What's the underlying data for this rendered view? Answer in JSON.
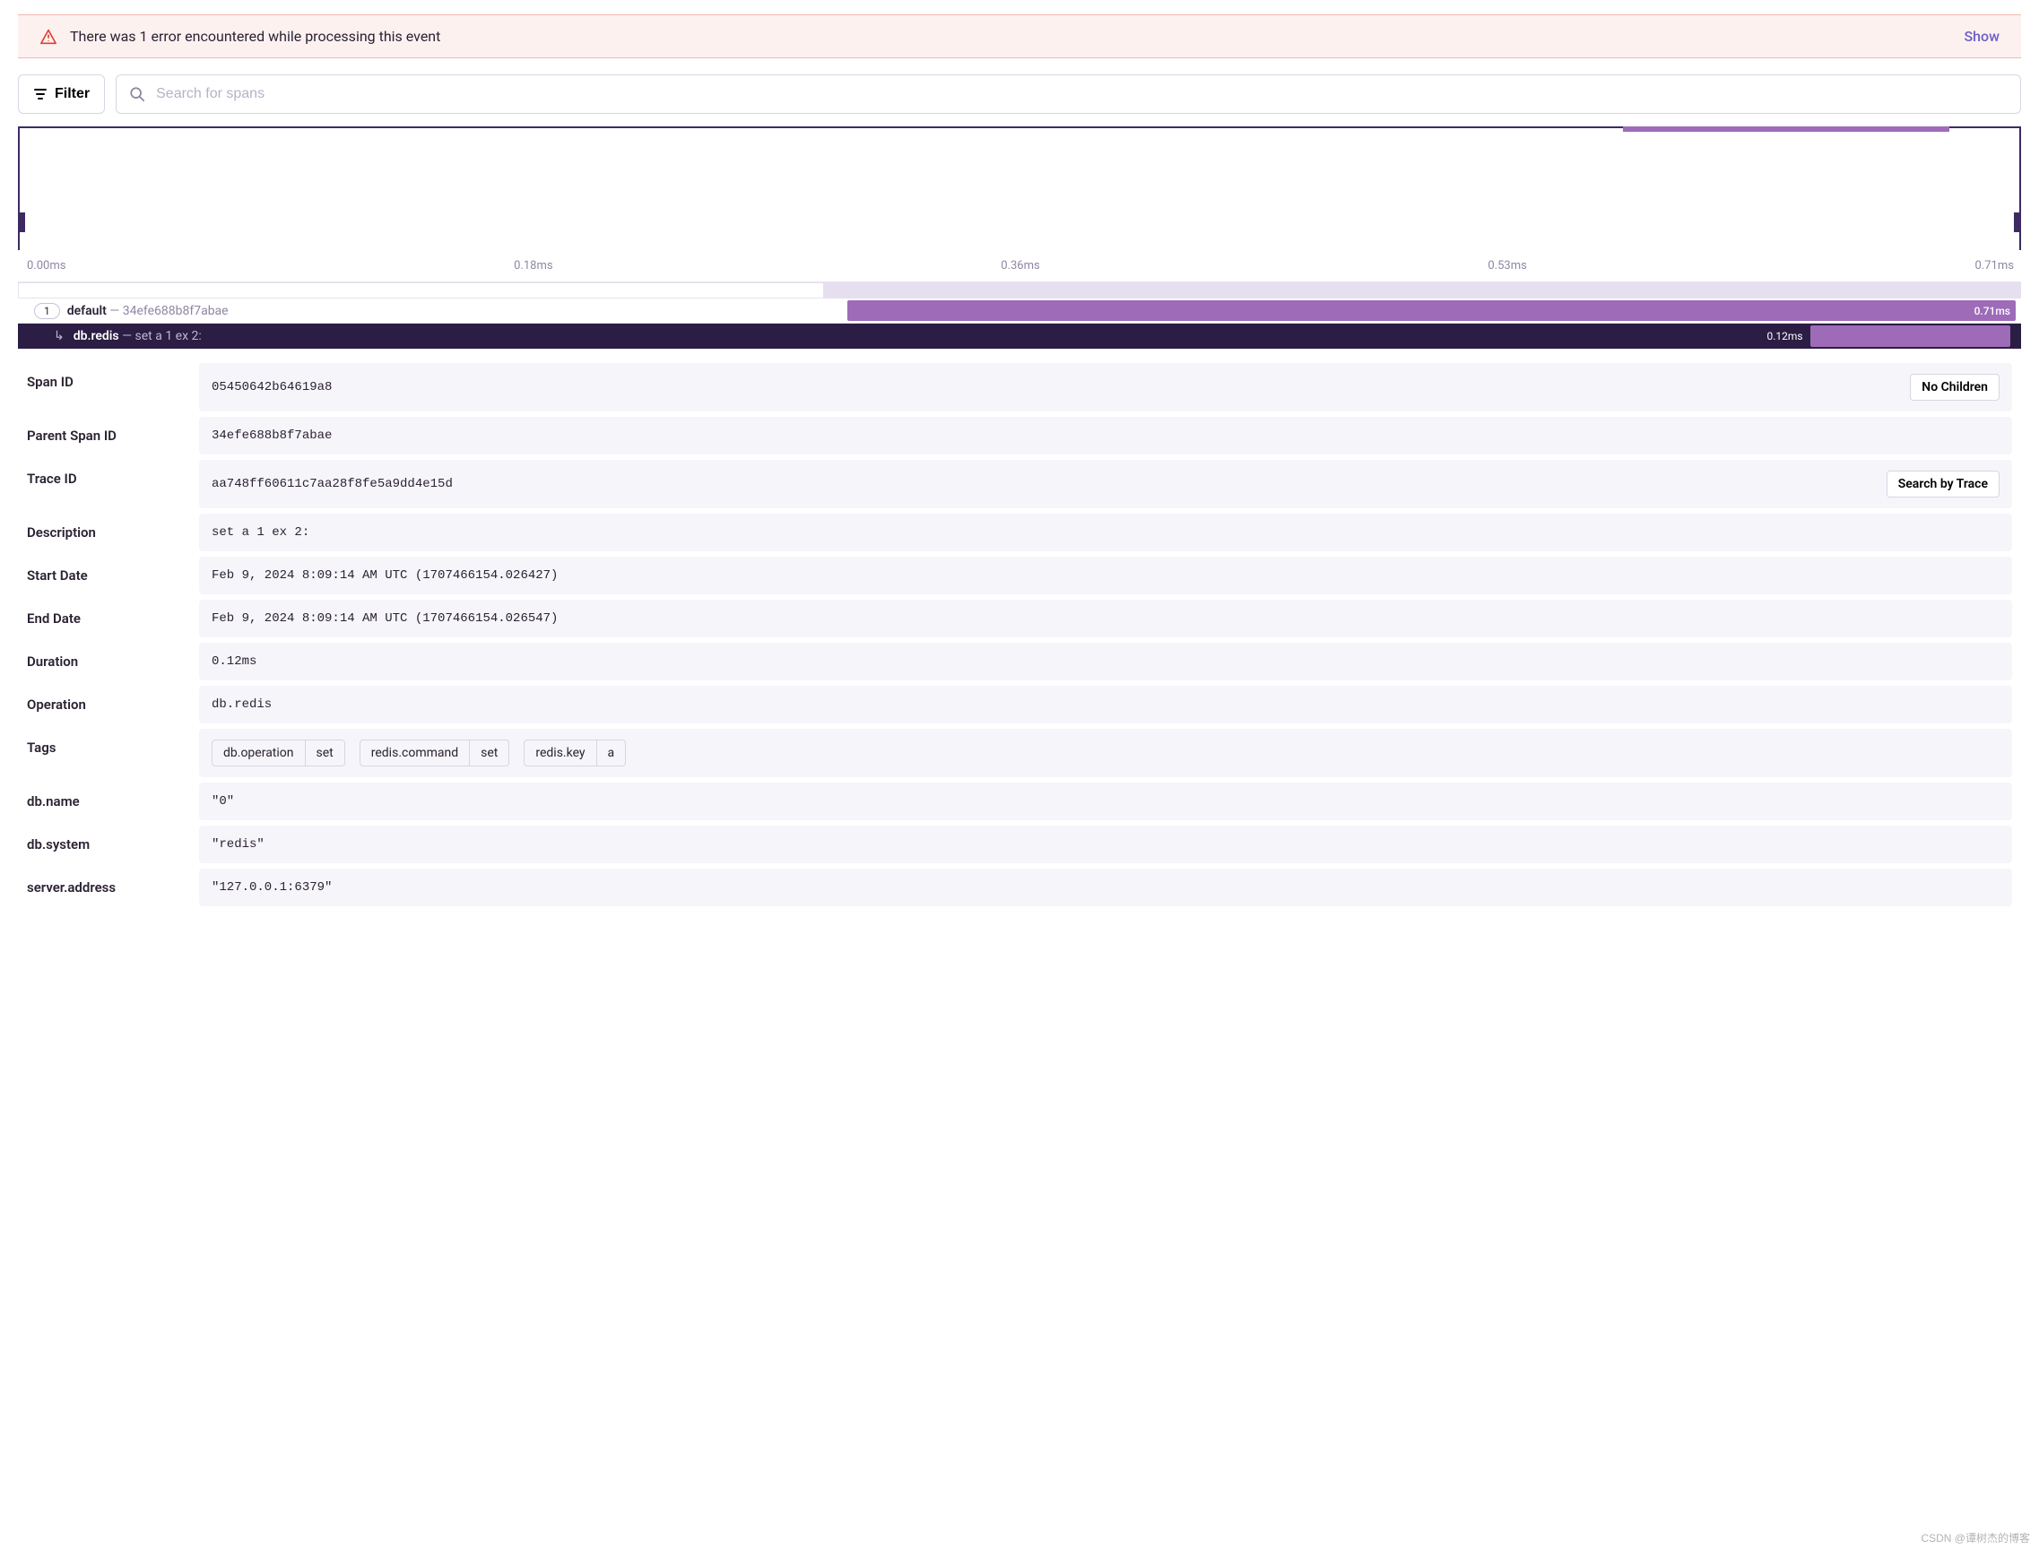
{
  "error_banner": {
    "message": "There was 1 error encountered while processing this event",
    "action": "Show"
  },
  "toolbar": {
    "filter_label": "Filter",
    "search_placeholder": "Search for spans"
  },
  "timeline": {
    "ticks": [
      "0.00ms",
      "0.18ms",
      "0.36ms",
      "0.53ms",
      "0.71ms"
    ]
  },
  "spans": {
    "root": {
      "badge": "1",
      "op": "default",
      "sep": " — ",
      "id": "34efe688b8f7abae",
      "duration": "0.71ms"
    },
    "child": {
      "op": "db.redis",
      "sep": " — ",
      "desc": "set a 1 ex 2:",
      "duration": "0.12ms"
    }
  },
  "details": {
    "span_id": {
      "label": "Span ID",
      "value": "05450642b64619a8",
      "action": "No Children"
    },
    "parent_span_id": {
      "label": "Parent Span ID",
      "value": "34efe688b8f7abae"
    },
    "trace_id": {
      "label": "Trace ID",
      "value": "aa748ff60611c7aa28f8fe5a9dd4e15d",
      "action": "Search by Trace"
    },
    "description": {
      "label": "Description",
      "value": "set a 1 ex 2:"
    },
    "start_date": {
      "label": "Start Date",
      "value": "Feb 9, 2024 8:09:14 AM UTC (1707466154.026427)"
    },
    "end_date": {
      "label": "End Date",
      "value": "Feb 9, 2024 8:09:14 AM UTC (1707466154.026547)"
    },
    "duration": {
      "label": "Duration",
      "value": "0.12ms"
    },
    "operation": {
      "label": "Operation",
      "value": "db.redis"
    },
    "tags": {
      "label": "Tags",
      "items": [
        {
          "k": "db.operation",
          "v": "set"
        },
        {
          "k": "redis.command",
          "v": "set"
        },
        {
          "k": "redis.key",
          "v": "a"
        }
      ]
    },
    "db_name": {
      "label": "db.name",
      "value": "\"0\""
    },
    "db_system": {
      "label": "db.system",
      "value": "\"redis\""
    },
    "server_address": {
      "label": "server.address",
      "value": "\"127.0.0.1:6379\""
    }
  },
  "watermark": "CSDN @谭树杰的博客"
}
